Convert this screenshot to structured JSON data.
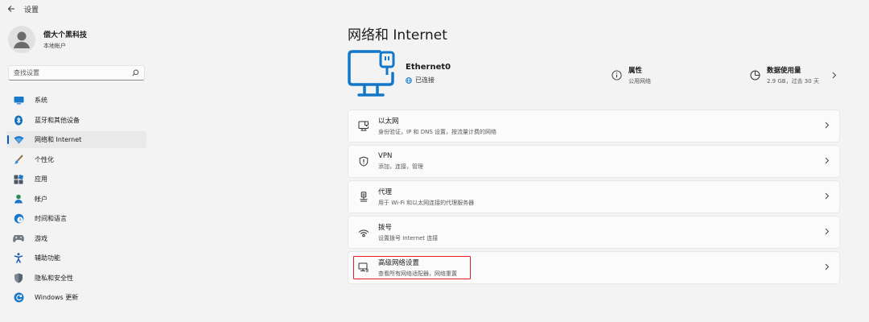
{
  "window": {
    "title": "设置"
  },
  "profile": {
    "name": "偿大个黑科技",
    "subtitle": "本地帐户"
  },
  "search": {
    "placeholder": "查找设置"
  },
  "sidebar": {
    "items": [
      {
        "label": "系统",
        "icon": "system-icon"
      },
      {
        "label": "蓝牙和其他设备",
        "icon": "bluetooth-icon"
      },
      {
        "label": "网络和 Internet",
        "icon": "wifi-icon",
        "selected": true
      },
      {
        "label": "个性化",
        "icon": "brush-icon"
      },
      {
        "label": "应用",
        "icon": "apps-icon"
      },
      {
        "label": "帐户",
        "icon": "account-icon"
      },
      {
        "label": "时间和语言",
        "icon": "globe-clock-icon"
      },
      {
        "label": "游戏",
        "icon": "gamepad-icon"
      },
      {
        "label": "辅助功能",
        "icon": "accessibility-icon"
      },
      {
        "label": "隐私和安全性",
        "icon": "shield-icon"
      },
      {
        "label": "Windows 更新",
        "icon": "update-icon"
      }
    ]
  },
  "main": {
    "title": "网络和 Internet",
    "ethernet": {
      "name": "Ethernet0",
      "status": "已连接"
    },
    "properties": {
      "title": "属性",
      "subtitle": "公用网络"
    },
    "usage": {
      "title": "数据使用量",
      "subtitle": "2.9 GB，过去 30 天"
    },
    "cards": [
      {
        "title": "以太网",
        "subtitle": "身份验证，IP 和 DNS 设置，按流量计费的网络",
        "icon": "ethernet-icon"
      },
      {
        "title": "VPN",
        "subtitle": "添加，连接，管理",
        "icon": "vpn-shield-icon"
      },
      {
        "title": "代理",
        "subtitle": "用于 Wi-Fi 和以太网连接的代理服务器",
        "icon": "proxy-icon"
      },
      {
        "title": "拨号",
        "subtitle": "设置拨号 Internet 连接",
        "icon": "dialup-icon"
      },
      {
        "title": "高级网络设置",
        "subtitle": "查看所有网络适配器，网络重置",
        "icon": "advanced-network-icon"
      }
    ]
  },
  "colors": {
    "accent": "#005fb8",
    "highlight": "#e02020",
    "background": "#f3f3f3",
    "card": "#fbfbfb"
  }
}
